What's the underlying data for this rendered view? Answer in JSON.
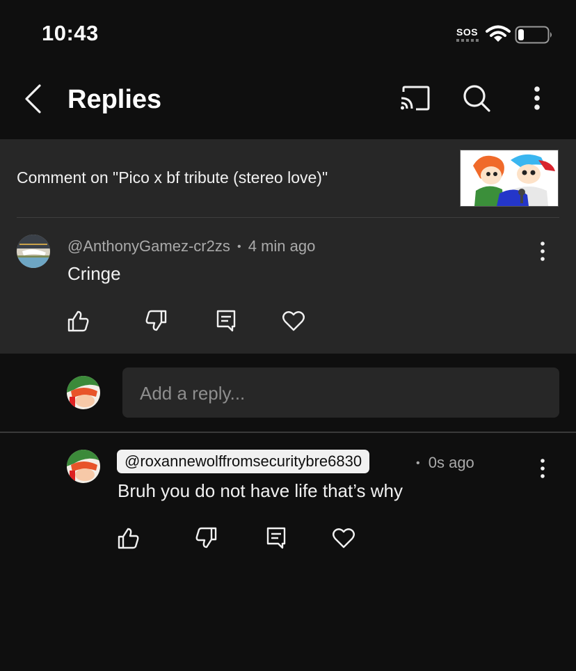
{
  "status_bar": {
    "time": "10:43",
    "sos": "SOS",
    "icons": [
      "wifi-icon",
      "battery-icon"
    ]
  },
  "app_bar": {
    "title": "Replies",
    "icons": [
      "back-icon",
      "cast-icon",
      "search-icon",
      "more-icon"
    ]
  },
  "context": {
    "text": "Comment on \"Pico x bf tribute (stereo love)\""
  },
  "comment": {
    "author": "@AnthonyGamez-cr2zs",
    "separator": "•",
    "time": "4 min ago",
    "text": "Cringe",
    "actions": [
      "like-icon",
      "dislike-icon",
      "reply-icon",
      "heart-icon"
    ]
  },
  "reply_input": {
    "placeholder": "Add a reply..."
  },
  "reply": {
    "author": "@roxannewolffromsecuritybre6830",
    "separator": "•",
    "time": "0s ago",
    "text": "Bruh you do not have life that’s why",
    "actions": [
      "like-icon",
      "dislike-icon",
      "reply-icon",
      "heart-icon"
    ]
  },
  "colors": {
    "background": "#0f0f0f",
    "panel": "#272727",
    "text_primary": "#f1f1f1",
    "text_secondary": "#aaaaaa"
  }
}
